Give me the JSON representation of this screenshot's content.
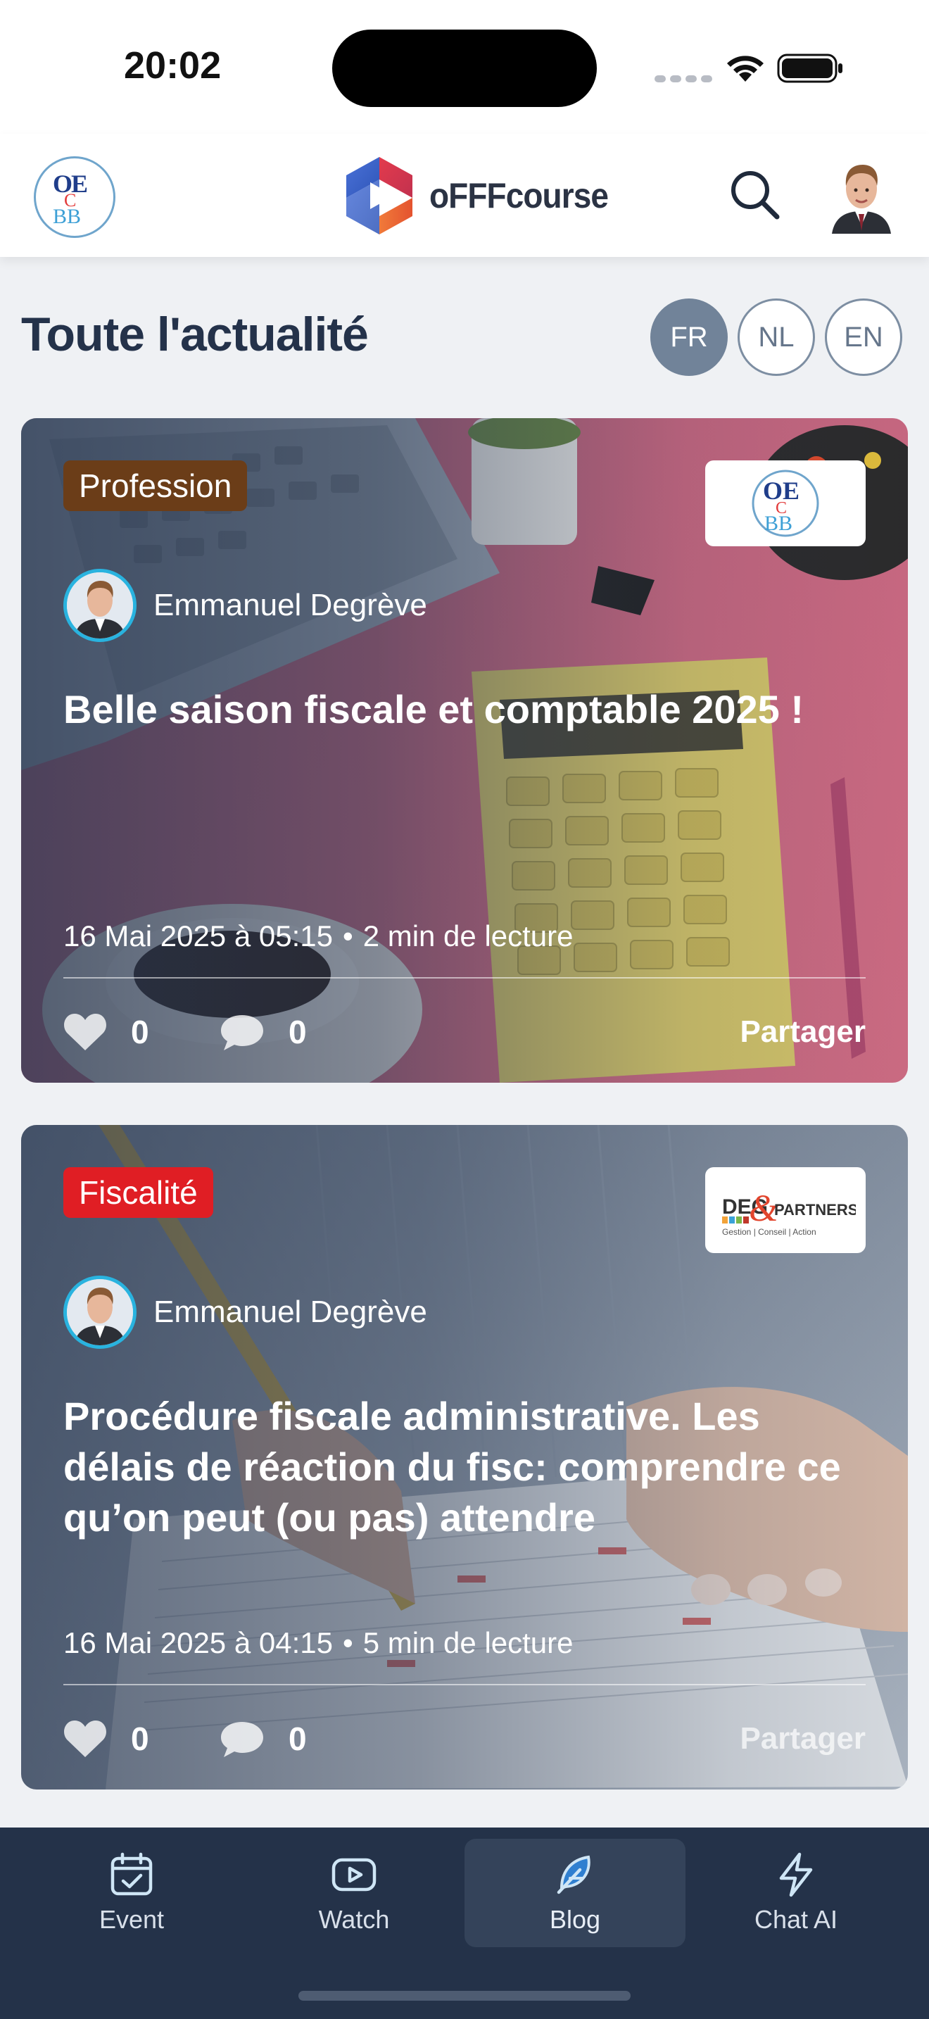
{
  "status_bar": {
    "time": "20:02"
  },
  "header": {
    "brand_name": "oFFFcourse",
    "left_logo_icon": "oec-logo-icon",
    "search_icon": "search-icon",
    "avatar_icon": "user-avatar-icon"
  },
  "page": {
    "title": "Toute l'actualité",
    "languages": [
      {
        "code": "FR",
        "active": true
      },
      {
        "code": "NL",
        "active": false
      },
      {
        "code": "EN",
        "active": false
      }
    ]
  },
  "posts": [
    {
      "category": "Profession",
      "category_color": "#6b3d18",
      "author": "Emmanuel Degrève",
      "title": "Belle saison fiscale et comptable 2025 !",
      "date": "16 Mai 2025 à 05:15",
      "read_time": "2 min de lecture",
      "likes": "0",
      "comments": "0",
      "share_label": "Partager",
      "partner_logo": "oec-logo-icon"
    },
    {
      "category": "Fiscalité",
      "category_color": "#e01e24",
      "author": "Emmanuel Degrève",
      "title": "Procédure fiscale administrative.  Les délais de réaction du fisc: comprendre ce qu’on peut (ou pas) attendre",
      "date": "16 Mai 2025 à 04:15",
      "read_time": "5 min de lecture",
      "likes": "0",
      "comments": "0",
      "share_label": "Partager",
      "partner_logo": {
        "brand": "DEG",
        "amp": "&",
        "partner": "PARTNERS",
        "tagline": "Gestion | Conseil | Action"
      }
    }
  ],
  "meta_separator": "•",
  "bottom_nav": [
    {
      "label": "Event",
      "icon": "calendar-check-icon",
      "active": false
    },
    {
      "label": "Watch",
      "icon": "play-video-icon",
      "active": false
    },
    {
      "label": "Blog",
      "icon": "feather-pen-icon",
      "active": true
    },
    {
      "label": "Chat AI",
      "icon": "lightning-icon",
      "active": false
    }
  ],
  "colors": {
    "nav_background": "#243249",
    "accent_blue": "#29b3df",
    "lang_active": "#718399"
  }
}
